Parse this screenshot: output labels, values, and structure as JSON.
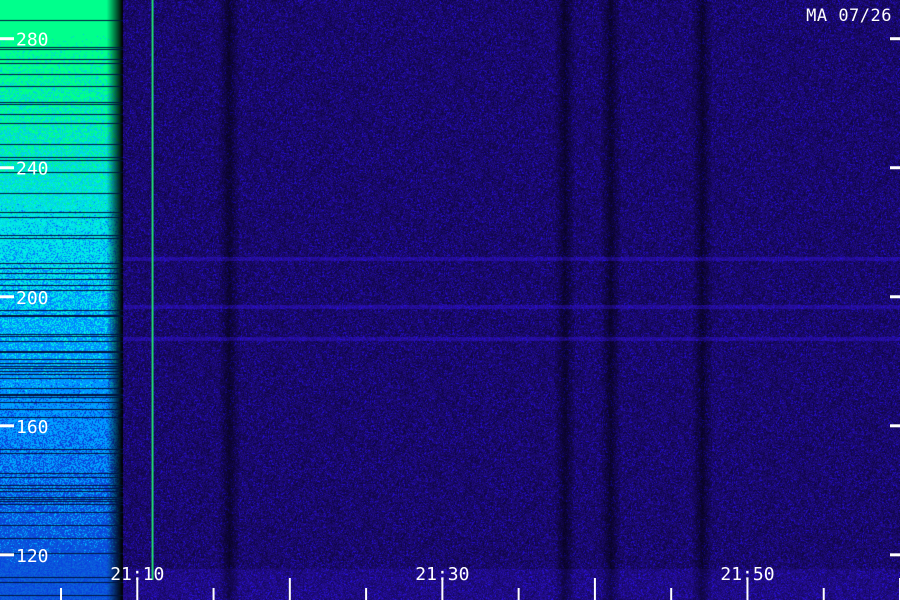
{
  "station_label": "MA 07/26",
  "chart_data": {
    "type": "heatmap",
    "title": "",
    "xlabel": "",
    "ylabel": "",
    "x_ticks": [
      "21:10",
      "21:30",
      "21:50"
    ],
    "y_ticks": [
      280,
      240,
      200,
      160,
      120
    ],
    "ylim": [
      106,
      292
    ],
    "xlim": [
      "21:01",
      "22:00"
    ],
    "colormap": [
      "#000000",
      "#1a0a3e",
      "#2a1580",
      "#3a20c8",
      "#1464ff",
      "#00c8ff",
      "#00ff80"
    ],
    "bright_band_end": "21:09",
    "marker_time": "21:11",
    "marker_color": "#20d070",
    "horizontal_lines_freq": [
      197,
      187,
      212
    ],
    "dark_columns_time": [
      "21:16",
      "21:38",
      "21:41",
      "21:47"
    ]
  }
}
